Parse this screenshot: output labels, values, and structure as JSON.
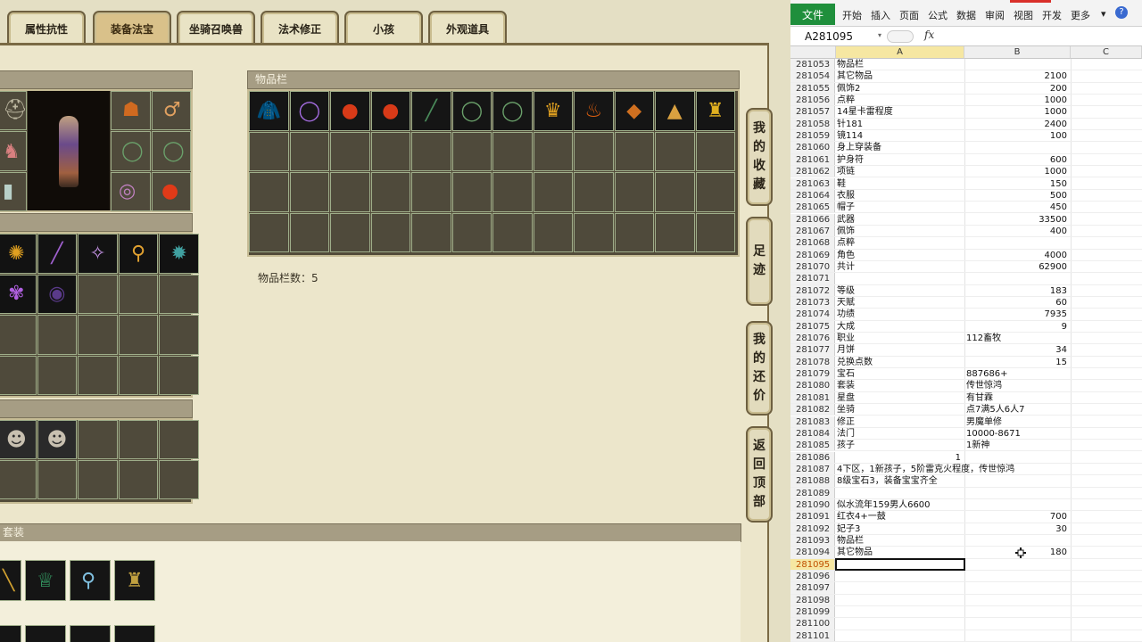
{
  "tabs": [
    {
      "label": "属性抗性",
      "active": false
    },
    {
      "label": "装备法宝",
      "active": true
    },
    {
      "label": "坐骑召唤兽",
      "active": false
    },
    {
      "label": "法术修正",
      "active": false
    },
    {
      "label": "小孩",
      "active": false
    },
    {
      "label": "外观道具",
      "active": false
    }
  ],
  "inventory": {
    "title": "物品栏",
    "count_label": "物品栏数：5",
    "items": [
      {
        "icon": "blue-cloak-icon",
        "glyph": "🧥",
        "color": "#3a52d8"
      },
      {
        "icon": "purple-necklace-icon",
        "glyph": "◯",
        "color": "#a46ce0"
      },
      {
        "icon": "red-orb-icon",
        "glyph": "●",
        "color": "#d83a18"
      },
      {
        "icon": "red-orb-icon",
        "glyph": "●",
        "color": "#d83a18"
      },
      {
        "icon": "jade-sword-icon",
        "glyph": "╱",
        "color": "#4a8a5a"
      },
      {
        "icon": "ring-icon",
        "glyph": "◯",
        "color": "#6aa06a"
      },
      {
        "icon": "ring-icon",
        "glyph": "◯",
        "color": "#6aa06a"
      },
      {
        "icon": "golden-helmet-icon",
        "glyph": "♛",
        "color": "#e0a020"
      },
      {
        "icon": "fire-armor-icon",
        "glyph": "♨",
        "color": "#e06010"
      },
      {
        "icon": "amber-gem-icon",
        "glyph": "◆",
        "color": "#d07020"
      },
      {
        "icon": "golden-hat-icon",
        "glyph": "▲",
        "color": "#d8a040"
      },
      {
        "icon": "golden-robe-icon",
        "glyph": "♜",
        "color": "#e0b020"
      }
    ]
  },
  "outfit": {
    "title": "套装"
  },
  "side_buttons": [
    {
      "name": "favorites-button",
      "chars": [
        "我",
        "的",
        "收",
        "藏"
      ]
    },
    {
      "name": "footprint-button",
      "chars": [
        "足",
        "迹"
      ]
    },
    {
      "name": "bargain-button",
      "chars": [
        "我",
        "的",
        "还",
        "价"
      ]
    },
    {
      "name": "back-to-top-button",
      "chars": [
        "返",
        "回",
        "顶",
        "部"
      ]
    }
  ],
  "excel": {
    "file_label": "文件",
    "ribbon_tabs": [
      "开始",
      "插入",
      "页面",
      "公式",
      "数据",
      "审阅",
      "视图",
      "开发",
      "更多"
    ],
    "name_box": "A281095",
    "fx": "fx",
    "col_a": "A",
    "col_b": "B",
    "col_c": "C",
    "rows": [
      {
        "n": "281053",
        "a": "物品栏",
        "b": "",
        "t": "num"
      },
      {
        "n": "281054",
        "a": "其它物品",
        "b": "2100",
        "t": "num"
      },
      {
        "n": "281055",
        "a": "佩饰2",
        "b": "200",
        "t": "num"
      },
      {
        "n": "281056",
        "a": "点粹",
        "b": "1000",
        "t": "num"
      },
      {
        "n": "281057",
        "a": "14星卡雷程度",
        "b": "1000",
        "t": "num"
      },
      {
        "n": "281058",
        "a": "针181",
        "b": "2400",
        "t": "num"
      },
      {
        "n": "281059",
        "a": "镜114",
        "b": "100",
        "t": "num"
      },
      {
        "n": "281060",
        "a": "身上穿装备",
        "b": "",
        "t": "num"
      },
      {
        "n": "281061",
        "a": "护身符",
        "b": "600",
        "t": "num"
      },
      {
        "n": "281062",
        "a": "项链",
        "b": "1000",
        "t": "num"
      },
      {
        "n": "281063",
        "a": "鞋",
        "b": "150",
        "t": "num"
      },
      {
        "n": "281064",
        "a": "衣服",
        "b": "500",
        "t": "num"
      },
      {
        "n": "281065",
        "a": "帽子",
        "b": "450",
        "t": "num"
      },
      {
        "n": "281066",
        "a": "武器",
        "b": "33500",
        "t": "num"
      },
      {
        "n": "281067",
        "a": "佩饰",
        "b": "400",
        "t": "num"
      },
      {
        "n": "281068",
        "a": "点粹",
        "b": "",
        "t": "num"
      },
      {
        "n": "281069",
        "a": "角色",
        "b": "4000",
        "t": "num"
      },
      {
        "n": "281070",
        "a": "共计",
        "b": "62900",
        "t": "num"
      },
      {
        "n": "281071",
        "a": "",
        "b": "",
        "t": "num"
      },
      {
        "n": "281072",
        "a": "等级",
        "b": "183",
        "t": "num"
      },
      {
        "n": "281073",
        "a": "天赋",
        "b": "60",
        "t": "num"
      },
      {
        "n": "281074",
        "a": "功绩",
        "b": "7935",
        "t": "num"
      },
      {
        "n": "281075",
        "a": "大成",
        "b": "9",
        "t": "num"
      },
      {
        "n": "281076",
        "a": "职业",
        "b": "112畜牧",
        "t": "txt"
      },
      {
        "n": "281077",
        "a": "月饼",
        "b": "34",
        "t": "num"
      },
      {
        "n": "281078",
        "a": "兑换点数",
        "b": "15",
        "t": "num"
      },
      {
        "n": "281079",
        "a": "宝石",
        "b": "887686+",
        "t": "txt"
      },
      {
        "n": "281080",
        "a": "套装",
        "b": "传世惊鸿",
        "t": "txt"
      },
      {
        "n": "281081",
        "a": "星盘",
        "b": "有甘霖",
        "t": "txt"
      },
      {
        "n": "281082",
        "a": "坐骑",
        "b": "点7满5人6人7",
        "t": "txt"
      },
      {
        "n": "281083",
        "a": "修正",
        "b": "男魔单修",
        "t": "txt"
      },
      {
        "n": "281084",
        "a": "法门",
        "b": "10000-8671",
        "t": "txt"
      },
      {
        "n": "281085",
        "a": "孩子",
        "b": "1新神",
        "t": "txt"
      },
      {
        "n": "281086",
        "a": "1",
        "b": "",
        "t": "num",
        "a_right": true
      },
      {
        "n": "281087",
        "a": "4下区，1新孩子，5阶雷克火程度，传世惊鸿",
        "b": "",
        "t": "num"
      },
      {
        "n": "281088",
        "a": "8级宝石3，装备宝宝齐全",
        "b": "",
        "t": "num"
      },
      {
        "n": "281089",
        "a": "",
        "b": "",
        "t": "num"
      },
      {
        "n": "281090",
        "a": "似水流年159男人6600",
        "b": "",
        "t": "num"
      },
      {
        "n": "281091",
        "a": "红衣4+一鼓",
        "b": "700",
        "t": "num"
      },
      {
        "n": "281092",
        "a": "妃子3",
        "b": "30",
        "t": "num"
      },
      {
        "n": "281093",
        "a": "物品栏",
        "b": "",
        "t": "num"
      },
      {
        "n": "281094",
        "a": "其它物品",
        "b": "180",
        "t": "num"
      },
      {
        "n": "281095",
        "a": "",
        "b": "",
        "t": "num",
        "selected": true
      },
      {
        "n": "281096",
        "a": "",
        "b": "",
        "t": "num"
      },
      {
        "n": "281097",
        "a": "",
        "b": "",
        "t": "num"
      },
      {
        "n": "281098",
        "a": "",
        "b": "",
        "t": "num"
      },
      {
        "n": "281099",
        "a": "",
        "b": "",
        "t": "num"
      },
      {
        "n": "281100",
        "a": "",
        "b": "",
        "t": "num"
      },
      {
        "n": "281101",
        "a": "",
        "b": "",
        "t": "num"
      }
    ]
  }
}
